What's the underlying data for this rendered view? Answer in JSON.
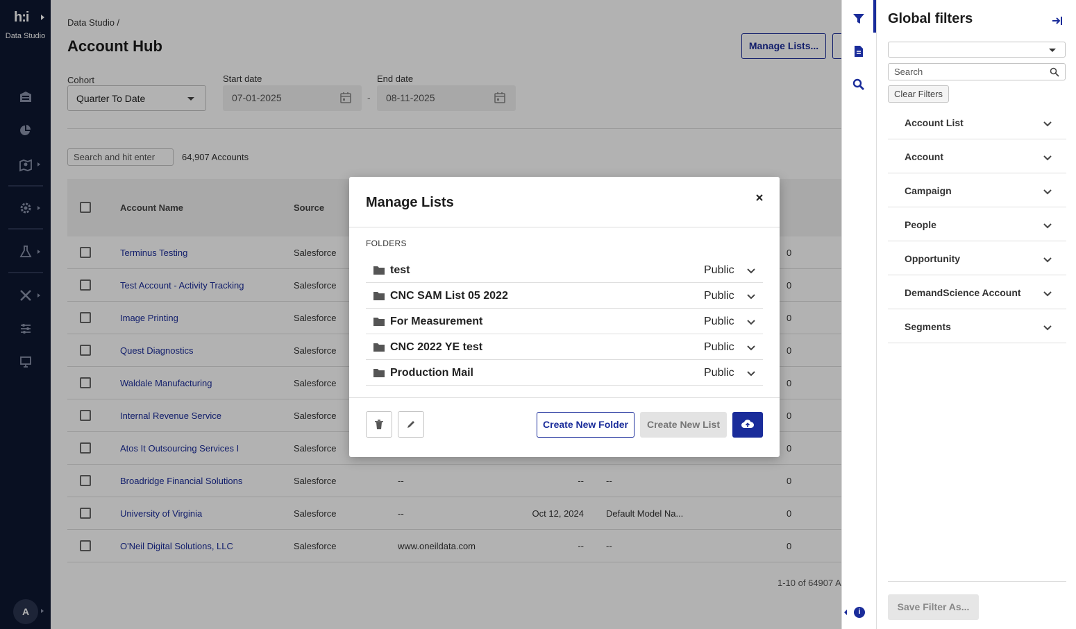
{
  "nav": {
    "logo_text": "h:i",
    "app_name": "Data Studio",
    "avatar_initial": "A"
  },
  "header": {
    "breadcrumb": "Data Studio /",
    "title": "Account Hub",
    "manage_lists_button": "Manage Lists..."
  },
  "filters": {
    "cohort_label": "Cohort",
    "cohort_value": "Quarter To Date",
    "start_label": "Start date",
    "start_value": "07-01-2025",
    "end_label": "End date",
    "end_value": "08-11-2025",
    "separator": "-"
  },
  "search": {
    "placeholder": "Search and hit enter",
    "count": "64,907 Accounts"
  },
  "table": {
    "headers": [
      "Account Name",
      "Source"
    ],
    "rows": [
      {
        "name": "Terminus Testing",
        "source": "Salesforce",
        "website": "",
        "date": "",
        "model": "",
        "value": "0"
      },
      {
        "name": "Test Account - Activity Tracking",
        "source": "Salesforce",
        "website": "",
        "date": "",
        "model": "",
        "value": "0"
      },
      {
        "name": "Image Printing",
        "source": "Salesforce",
        "website": "",
        "date": "",
        "model": "",
        "value": "0"
      },
      {
        "name": "Quest Diagnostics",
        "source": "Salesforce",
        "website": "",
        "date": "",
        "model": "",
        "value": "0"
      },
      {
        "name": "Waldale Manufacturing",
        "source": "Salesforce",
        "website": "",
        "date": "",
        "model": "",
        "value": "0"
      },
      {
        "name": "Internal Revenue Service",
        "source": "Salesforce",
        "website": "",
        "date": "",
        "model": "",
        "value": "0"
      },
      {
        "name": "Atos It Outsourcing Services I",
        "source": "Salesforce",
        "website": "",
        "date": "",
        "model": "",
        "value": "0"
      },
      {
        "name": "Broadridge Financial Solutions",
        "source": "Salesforce",
        "website": "--",
        "date": "--",
        "model": "--",
        "value": "0"
      },
      {
        "name": "University of Virginia",
        "source": "Salesforce",
        "website": "--",
        "date": "Oct 12, 2024",
        "model": "Default Model Na...",
        "value": "0"
      },
      {
        "name": "O'Neil Digital Solutions, LLC",
        "source": "Salesforce",
        "website": "www.oneildata.com",
        "date": "--",
        "model": "--",
        "value": "0"
      }
    ],
    "pagination": "1-10 of 64907 A"
  },
  "global_filters": {
    "title": "Global filters",
    "search_placeholder": "Search",
    "clear_label": "Clear Filters",
    "items": [
      "Account List",
      "Account",
      "Campaign",
      "People",
      "Opportunity",
      "DemandScience Account",
      "Segments"
    ],
    "save_label": "Save Filter As..."
  },
  "modal": {
    "title": "Manage Lists",
    "folders_label": "FOLDERS",
    "folders": [
      {
        "name": "test",
        "visibility": "Public"
      },
      {
        "name": "CNC SAM List 05 2022",
        "visibility": "Public"
      },
      {
        "name": "For Measurement",
        "visibility": "Public"
      },
      {
        "name": "CNC 2022 YE test",
        "visibility": "Public"
      },
      {
        "name": "Production Mail",
        "visibility": "Public"
      }
    ],
    "create_folder_label": "Create New Folder",
    "create_list_label": "Create New List"
  },
  "colors": {
    "accent": "#1a2c9a",
    "nav_bg": "#0e1731"
  }
}
